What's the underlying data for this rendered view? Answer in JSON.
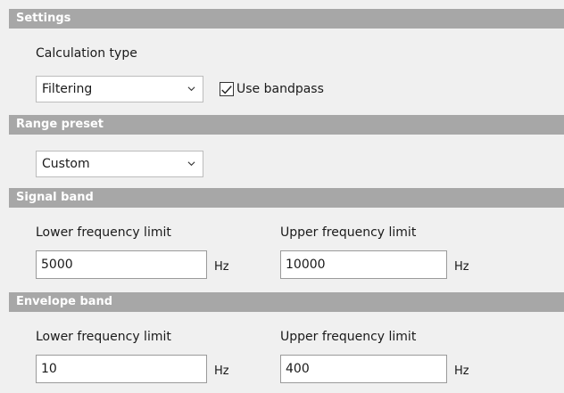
{
  "settings": {
    "header": "Settings",
    "calculation_type_label": "Calculation type",
    "calculation_type_value": "Filtering",
    "use_bandpass_label": "Use bandpass",
    "use_bandpass_checked": true
  },
  "range_preset": {
    "header": "Range preset",
    "value": "Custom"
  },
  "signal_band": {
    "header": "Signal band",
    "lower_label": "Lower frequency limit",
    "lower_value": "5000",
    "lower_unit": "Hz",
    "upper_label": "Upper frequency limit",
    "upper_value": "10000",
    "upper_unit": "Hz"
  },
  "envelope_band": {
    "header": "Envelope band",
    "lower_label": "Lower frequency limit",
    "lower_value": "10",
    "lower_unit": "Hz",
    "upper_label": "Upper frequency limit",
    "upper_value": "400",
    "upper_unit": "Hz"
  },
  "icons": {
    "dropdown": "chevron-down-icon",
    "check": "checkmark-icon"
  },
  "colors": {
    "header_bg": "#a7a7a7",
    "panel_bg": "#f0f0f0",
    "header_text": "#ffffff"
  }
}
